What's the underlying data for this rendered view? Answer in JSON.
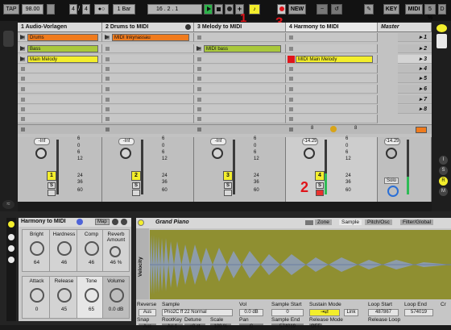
{
  "transport": {
    "tap": "TAP",
    "tempo": "98.00",
    "sig_num": "4",
    "sig_den": "4",
    "quant": "1 Bar",
    "position": "16 .  2 .  1",
    "new_label": "NEW",
    "key_label": "KEY",
    "midi_label": "MIDI",
    "cpu": "5 %",
    "d_label": "D"
  },
  "annotations": [
    "1",
    "3",
    "2"
  ],
  "tracks": [
    {
      "name": "1 Audio-Vorlagen",
      "volume": "-Inf",
      "num": "1"
    },
    {
      "name": "2 Drums to MIDI",
      "volume": "-Inf",
      "num": "2"
    },
    {
      "name": "3 Melody to MIDI",
      "volume": "-Inf",
      "num": "3"
    },
    {
      "name": "4 Harmony to MIDI",
      "volume": "-14.25",
      "num": "4"
    }
  ],
  "master": {
    "name": "Master",
    "volume": "-14.25",
    "solo_label": "Solo"
  },
  "clips": {
    "drums": "Drums",
    "bass": "Bass",
    "main_melody": "Main Melody",
    "midi_drums": "MIDI Inkynassau",
    "midi_bass": "MIDI bass",
    "midi_main_melody": "MIDI Main Melody"
  },
  "scenes": [
    "1",
    "2",
    "3",
    "4",
    "5",
    "6",
    "7",
    "8"
  ],
  "meter_scale": [
    "6",
    "0",
    "6",
    "12",
    "24",
    "36",
    "60"
  ],
  "mixer_marks": {
    "eight_a": "8",
    "eight_b": "8",
    "solo": "S"
  },
  "rack": {
    "title": "Harmony to MIDI",
    "map_label": "Map",
    "macros": [
      {
        "label": "Bright",
        "value": "64"
      },
      {
        "label": "Hardness",
        "value": "46"
      },
      {
        "label": "Comp",
        "value": "46"
      },
      {
        "label": "Reverb Amount",
        "value": "46 %"
      },
      {
        "label": "Attack",
        "value": "0"
      },
      {
        "label": "Release",
        "value": "45"
      },
      {
        "label": "Tone",
        "value": "65"
      },
      {
        "label": "Volume",
        "value": "0.0 dB"
      }
    ]
  },
  "sampler": {
    "title": "Grand Piano",
    "tabs": [
      "Zone",
      "Sample",
      "Pitch/Osc",
      "Filter/Global"
    ],
    "velocity_label": "Velocity",
    "reverse": {
      "label": "Reverse",
      "value": "Aus"
    },
    "sample": {
      "label": "Sample",
      "value": "Pno2C ff 22 Normal"
    },
    "vol": {
      "label": "Vol",
      "value": "0.0 dB"
    },
    "sample_start": {
      "label": "Sample Start",
      "value": "0"
    },
    "sustain_mode": {
      "label": "Sustain Mode",
      "link": "Link"
    },
    "loop_start": {
      "label": "Loop Start",
      "value": "487867"
    },
    "loop_end": {
      "label": "Loop End",
      "value": "574019"
    },
    "snap": {
      "label": "Snap",
      "value": "Aus"
    },
    "rootkey": {
      "label": "RootKey",
      "value": "A#-1"
    },
    "detune": {
      "label": "Detune",
      "value": "+0 ct"
    },
    "scale": {
      "label": "Scale",
      "value": "100 %"
    },
    "pan": {
      "label": "Pan",
      "value": "C"
    },
    "sample_end": {
      "label": "Sample End",
      "value": "574019"
    },
    "release_mode": {
      "label": "Release Mode",
      "value": "OFF"
    },
    "release_loop": {
      "label": "Release Loop"
    },
    "cr_label": "Cr"
  },
  "colors": {
    "orange_clip": "#f07b1d",
    "green_clip": "#a9c83b",
    "yellow_clip": "#f3ee2c",
    "annotation": "#e0141a"
  }
}
